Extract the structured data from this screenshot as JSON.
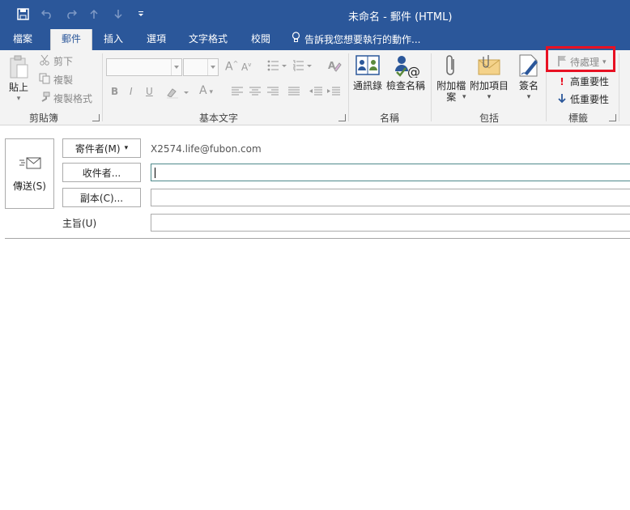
{
  "window": {
    "title": "未命名 - 郵件 (HTML)"
  },
  "quick_access": [
    {
      "name": "save-icon",
      "enabled": true
    },
    {
      "name": "undo-icon",
      "enabled": false
    },
    {
      "name": "redo-icon",
      "enabled": false
    },
    {
      "name": "up-arrow-icon",
      "enabled": false
    },
    {
      "name": "down-arrow-icon",
      "enabled": false
    },
    {
      "name": "customize-qat-icon",
      "enabled": true
    }
  ],
  "tabs": {
    "file": "檔案",
    "message": "郵件",
    "insert": "插入",
    "options": "選項",
    "format_text": "文字格式",
    "review": "校閱",
    "tell_me": "告訴我您想要執行的動作..."
  },
  "ribbon": {
    "clipboard": {
      "label": "剪貼簿",
      "paste": "貼上",
      "cut": "剪下",
      "copy": "複製",
      "format_painter": "複製格式"
    },
    "basic_text": {
      "label": "基本文字"
    },
    "names": {
      "label": "名稱",
      "address_book": "通訊錄",
      "check_names": "檢查名稱"
    },
    "include": {
      "label": "包括",
      "attach_file": "附加檔\n案",
      "attach_item": "附加項目",
      "signature": "簽名"
    },
    "tags": {
      "label": "標籤",
      "follow_up": "待處理",
      "high_importance": "高重要性",
      "low_importance": "低重要性"
    }
  },
  "compose": {
    "send": "傳送(S)",
    "from_button": "寄件者(M)",
    "from_address": "X2574.life@fubon.com",
    "to_button": "收件者...",
    "to_value": "",
    "cc_button": "副本(C)...",
    "cc_value": "",
    "subject_label": "主旨(U)",
    "subject_value": ""
  },
  "colors": {
    "titlebar": "#2b579a",
    "ribbon": "#f3f3f3",
    "highlight": "#e81123",
    "importance_high": "#e81123",
    "importance_low": "#2b579a"
  }
}
